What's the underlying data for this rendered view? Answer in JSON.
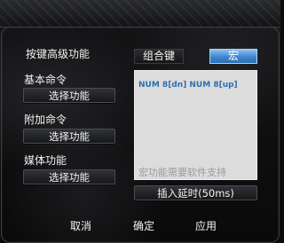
{
  "header": {
    "title": "按键高级功能"
  },
  "mode_tabs": {
    "combo_label": "组合键",
    "macro_label": "宏",
    "selected": "宏"
  },
  "sections": [
    {
      "label": "基本命令",
      "button_label": "选择功能"
    },
    {
      "label": "附加命令",
      "button_label": "选择功能"
    },
    {
      "label": "媒体功能",
      "button_label": "选择功能"
    }
  ],
  "macro_panel": {
    "content": "NUM 8[dn] NUM 8[up]",
    "hint": "宏功能需要软件支持"
  },
  "insert_delay": {
    "label": "插入延时(50ms)"
  },
  "footer": {
    "cancel_label": "取消",
    "ok_label": "确定",
    "apply_label": "应用"
  },
  "colors": {
    "accent": "#3d86cf",
    "macro_text": "#2f6fb0",
    "panel_bg": "#dcdcdc"
  }
}
